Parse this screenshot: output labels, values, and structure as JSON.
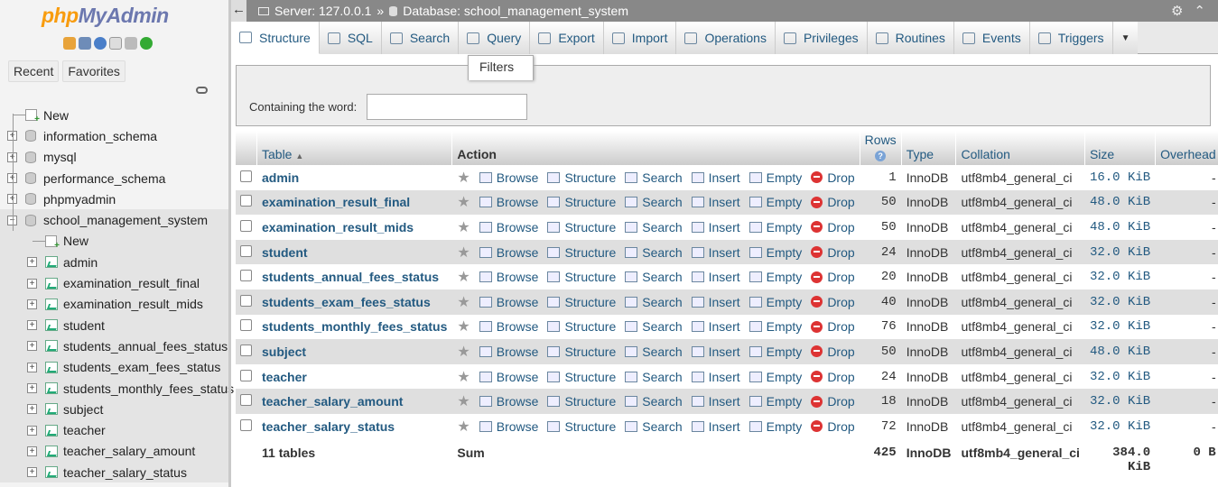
{
  "sidebar": {
    "logo_php": "php",
    "logo_my": "MyAdmin",
    "tabs": [
      "Recent",
      "Favorites"
    ],
    "tree": [
      {
        "label": "New",
        "depth": 0,
        "kind": "new"
      },
      {
        "label": "information_schema",
        "depth": 0,
        "kind": "db"
      },
      {
        "label": "mysql",
        "depth": 0,
        "kind": "db"
      },
      {
        "label": "performance_schema",
        "depth": 0,
        "kind": "db"
      },
      {
        "label": "phpmyadmin",
        "depth": 0,
        "kind": "db"
      },
      {
        "label": "school_management_system",
        "depth": 0,
        "kind": "db-open"
      },
      {
        "label": "New",
        "depth": 1,
        "kind": "new"
      },
      {
        "label": "admin",
        "depth": 1,
        "kind": "tbl"
      },
      {
        "label": "examination_result_final",
        "depth": 1,
        "kind": "tbl"
      },
      {
        "label": "examination_result_mids",
        "depth": 1,
        "kind": "tbl"
      },
      {
        "label": "student",
        "depth": 1,
        "kind": "tbl"
      },
      {
        "label": "students_annual_fees_status",
        "depth": 1,
        "kind": "tbl"
      },
      {
        "label": "students_exam_fees_status",
        "depth": 1,
        "kind": "tbl"
      },
      {
        "label": "students_monthly_fees_status",
        "depth": 1,
        "kind": "tbl"
      },
      {
        "label": "subject",
        "depth": 1,
        "kind": "tbl"
      },
      {
        "label": "teacher",
        "depth": 1,
        "kind": "tbl"
      },
      {
        "label": "teacher_salary_amount",
        "depth": 1,
        "kind": "tbl"
      },
      {
        "label": "teacher_salary_status",
        "depth": 1,
        "kind": "tbl"
      }
    ]
  },
  "topbar": {
    "server": "Server: 127.0.0.1",
    "sep": "»",
    "database": "Database: school_management_system"
  },
  "tabs": [
    "Structure",
    "SQL",
    "Search",
    "Query",
    "Export",
    "Import",
    "Operations",
    "Privileges",
    "Routines",
    "Events",
    "Triggers"
  ],
  "filters": {
    "title": "Filters",
    "label": "Containing the word:",
    "value": ""
  },
  "table": {
    "headers": {
      "table": "Table",
      "action": "Action",
      "rows": "Rows",
      "type": "Type",
      "collation": "Collation",
      "size": "Size",
      "overhead": "Overhead"
    },
    "actions": {
      "browse": "Browse",
      "structure": "Structure",
      "search": "Search",
      "insert": "Insert",
      "empty": "Empty",
      "drop": "Drop"
    },
    "rows": [
      {
        "name": "admin",
        "rows": "1",
        "type": "InnoDB",
        "collation": "utf8mb4_general_ci",
        "size": "16.0 KiB",
        "overhead": "-"
      },
      {
        "name": "examination_result_final",
        "rows": "50",
        "type": "InnoDB",
        "collation": "utf8mb4_general_ci",
        "size": "48.0 KiB",
        "overhead": "-"
      },
      {
        "name": "examination_result_mids",
        "rows": "50",
        "type": "InnoDB",
        "collation": "utf8mb4_general_ci",
        "size": "48.0 KiB",
        "overhead": "-"
      },
      {
        "name": "student",
        "rows": "24",
        "type": "InnoDB",
        "collation": "utf8mb4_general_ci",
        "size": "32.0 KiB",
        "overhead": "-"
      },
      {
        "name": "students_annual_fees_status",
        "rows": "20",
        "type": "InnoDB",
        "collation": "utf8mb4_general_ci",
        "size": "32.0 KiB",
        "overhead": "-"
      },
      {
        "name": "students_exam_fees_status",
        "rows": "40",
        "type": "InnoDB",
        "collation": "utf8mb4_general_ci",
        "size": "32.0 KiB",
        "overhead": "-"
      },
      {
        "name": "students_monthly_fees_status",
        "rows": "76",
        "type": "InnoDB",
        "collation": "utf8mb4_general_ci",
        "size": "32.0 KiB",
        "overhead": "-"
      },
      {
        "name": "subject",
        "rows": "50",
        "type": "InnoDB",
        "collation": "utf8mb4_general_ci",
        "size": "48.0 KiB",
        "overhead": "-"
      },
      {
        "name": "teacher",
        "rows": "24",
        "type": "InnoDB",
        "collation": "utf8mb4_general_ci",
        "size": "32.0 KiB",
        "overhead": "-"
      },
      {
        "name": "teacher_salary_amount",
        "rows": "18",
        "type": "InnoDB",
        "collation": "utf8mb4_general_ci",
        "size": "32.0 KiB",
        "overhead": "-"
      },
      {
        "name": "teacher_salary_status",
        "rows": "72",
        "type": "InnoDB",
        "collation": "utf8mb4_general_ci",
        "size": "32.0 KiB",
        "overhead": "-"
      }
    ],
    "summary": {
      "count": "11 tables",
      "label": "Sum",
      "rows": "425",
      "type": "InnoDB",
      "collation": "utf8mb4_general_ci",
      "size": "384.0",
      "size_unit": "KiB",
      "overhead": "0 B"
    }
  }
}
